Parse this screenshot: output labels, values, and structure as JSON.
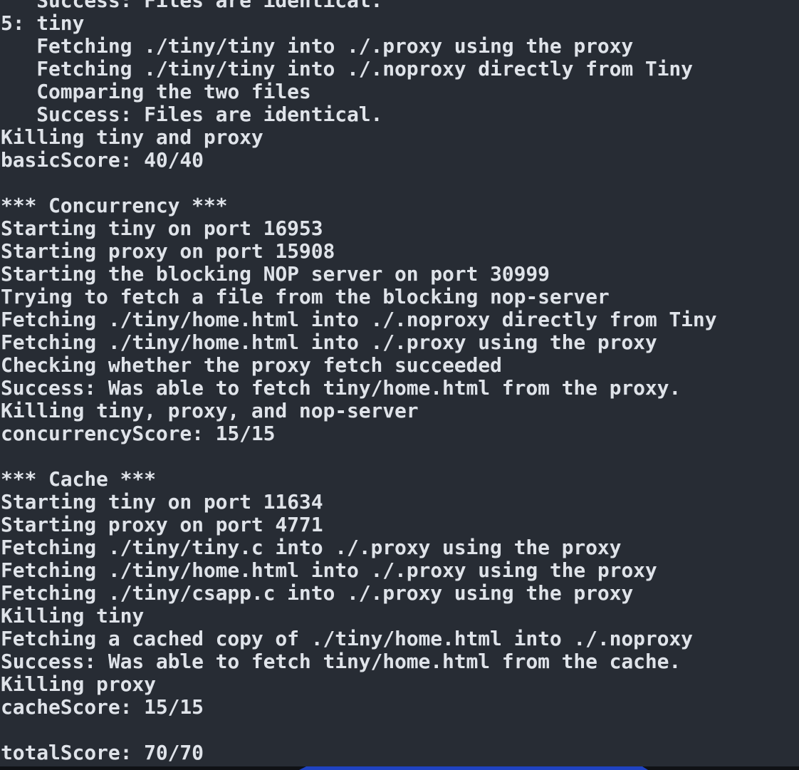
{
  "terminal": {
    "lines": [
      "   Success: Files are identical.",
      "5: tiny",
      "   Fetching ./tiny/tiny into ./.proxy using the proxy",
      "   Fetching ./tiny/tiny into ./.noproxy directly from Tiny",
      "   Comparing the two files",
      "   Success: Files are identical.",
      "Killing tiny and proxy",
      "basicScore: 40/40",
      "",
      "*** Concurrency ***",
      "Starting tiny on port 16953",
      "Starting proxy on port 15908",
      "Starting the blocking NOP server on port 30999",
      "Trying to fetch a file from the blocking nop-server",
      "Fetching ./tiny/home.html into ./.noproxy directly from Tiny",
      "Fetching ./tiny/home.html into ./.proxy using the proxy",
      "Checking whether the proxy fetch succeeded",
      "Success: Was able to fetch tiny/home.html from the proxy.",
      "Killing tiny, proxy, and nop-server",
      "concurrencyScore: 15/15",
      "",
      "*** Cache ***",
      "Starting tiny on port 11634",
      "Starting proxy on port 4771",
      "Fetching ./tiny/tiny.c into ./.proxy using the proxy",
      "Fetching ./tiny/home.html into ./.proxy using the proxy",
      "Fetching ./tiny/csapp.c into ./.proxy using the proxy",
      "Killing tiny",
      "Fetching a cached copy of ./tiny/home.html into ./.noproxy",
      "Success: Was able to fetch tiny/home.html from the cache.",
      "Killing proxy",
      "cacheScore: 15/15",
      "",
      "totalScore: 70/70"
    ]
  },
  "colors": {
    "background": "#272c34",
    "foreground": "#dfe3e9",
    "statusbar": "#0f1115",
    "statusbar_accent": "#1f43c2"
  }
}
